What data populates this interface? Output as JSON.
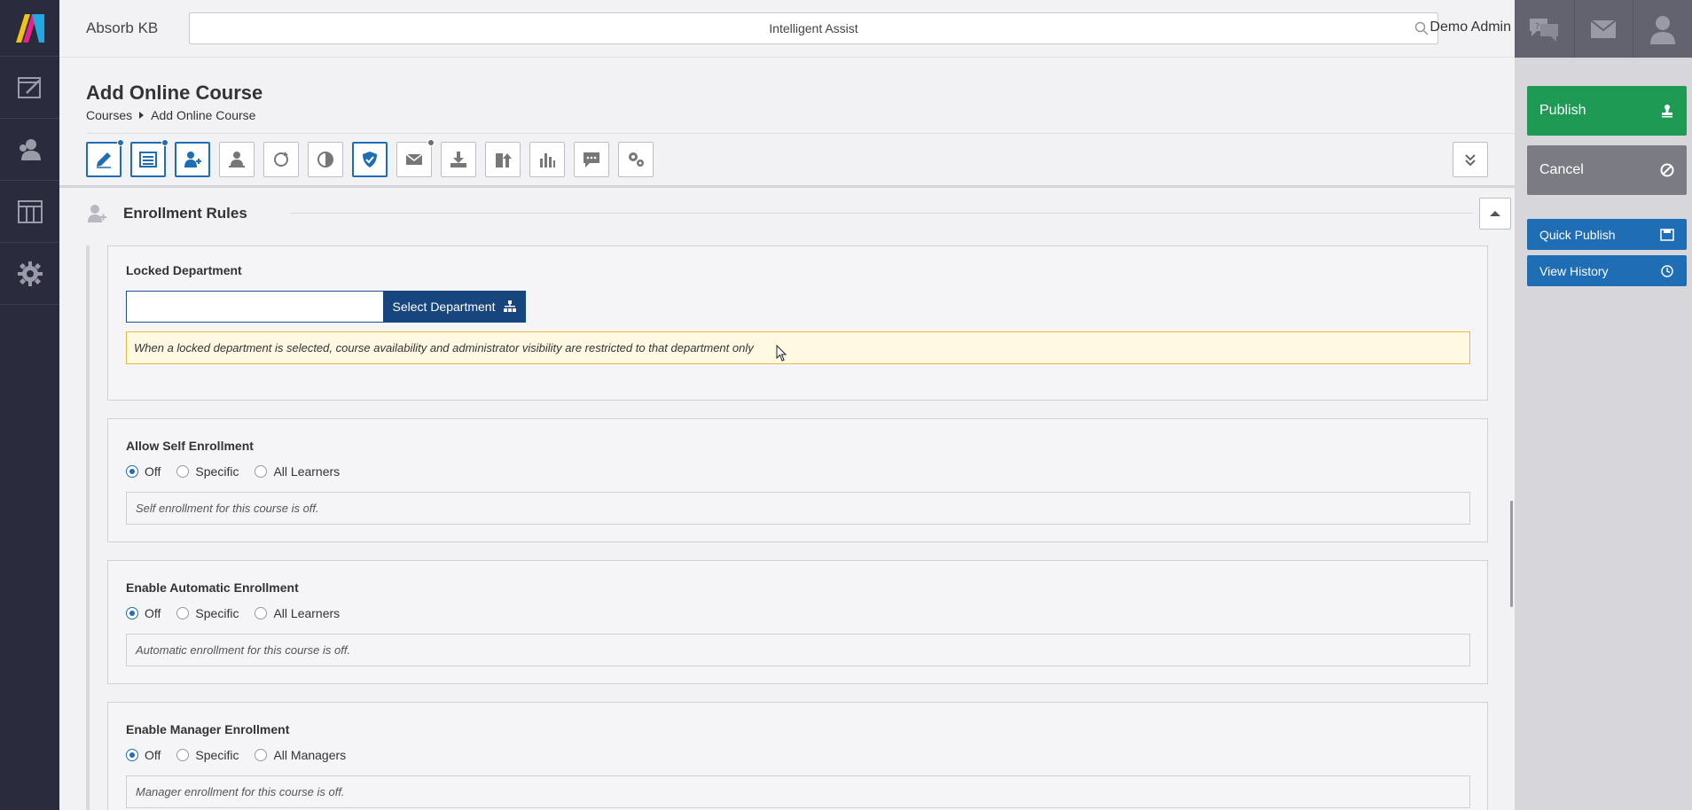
{
  "topbar": {
    "brand": "Absorb KB",
    "search_placeholder": "Intelligent Assist",
    "user": "Demo Admin"
  },
  "page": {
    "title": "Add Online Course",
    "breadcrumb": [
      "Courses",
      "Add Online Course"
    ]
  },
  "section": {
    "title": "Enrollment Rules"
  },
  "locked_department": {
    "label": "Locked Department",
    "button": "Select Department",
    "warning": "When a locked department is selected, course availability and administrator visibility are restricted to that department only"
  },
  "self_enrollment": {
    "label": "Allow Self Enrollment",
    "options": [
      "Off",
      "Specific",
      "All Learners"
    ],
    "selected": "Off",
    "note": "Self enrollment for this course is off."
  },
  "auto_enrollment": {
    "label": "Enable Automatic Enrollment",
    "options": [
      "Off",
      "Specific",
      "All Learners"
    ],
    "selected": "Off",
    "note": "Automatic enrollment for this course is off."
  },
  "manager_enrollment": {
    "label": "Enable Manager Enrollment",
    "options": [
      "Off",
      "Specific",
      "All Managers"
    ],
    "selected": "Off",
    "note": "Manager enrollment for this course is off."
  },
  "actions": {
    "publish": "Publish",
    "cancel": "Cancel",
    "quick_publish": "Quick Publish",
    "view_history": "View History"
  },
  "colors": {
    "accent": "#1f6db5",
    "publish": "#1f9a55",
    "cancel": "#7b7b83",
    "dept_button": "#17467e",
    "nav_bg": "#2a2b3d"
  }
}
